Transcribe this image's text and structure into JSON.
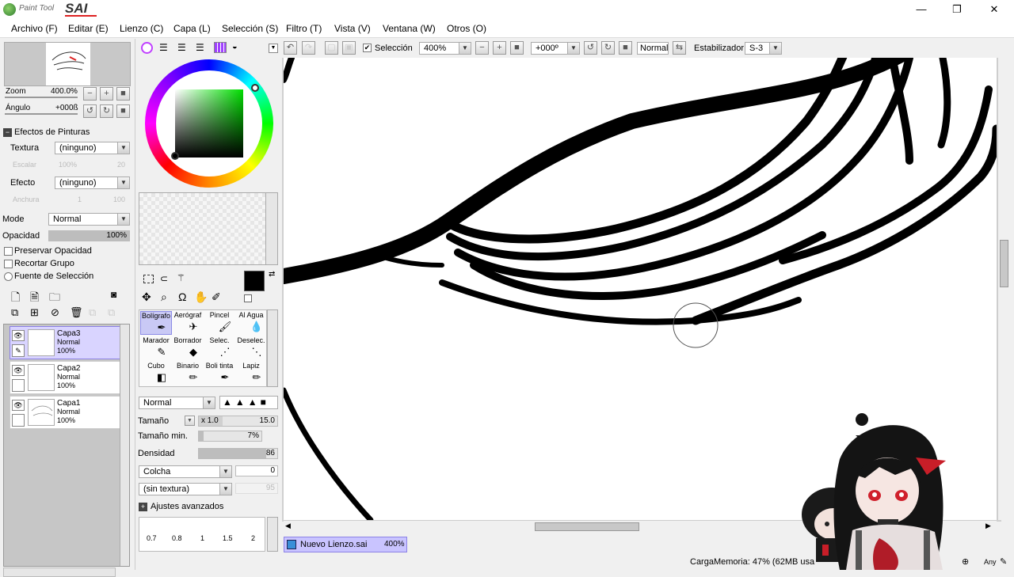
{
  "window": {
    "logo_small": "Paint Tool",
    "logo_big": "SAI",
    "min": "—",
    "max": "❐",
    "close": "✕"
  },
  "menu": [
    "Archivo (F)",
    "Editar (E)",
    "Lienzo (C)",
    "Capa (L)",
    "Selección (S)",
    "Filtro (T)",
    "Vista (V)",
    "Ventana (W)",
    "Otros (O)"
  ],
  "navigator": {
    "zoom_label": "Zoom",
    "zoom_value": "400.0%",
    "angle_label": "Ángulo",
    "angle_value": "+000ß"
  },
  "effects": {
    "title": "Efectos de Pinturas",
    "texture_label": "Textura",
    "texture_value": "(ninguno)",
    "scale_label": "Escalar",
    "scale_value": "100%",
    "scale_num": "20",
    "effect_label": "Efecto",
    "effect_value": "(ninguno)",
    "width_label": "Anchura",
    "width_value": "1",
    "width_num": "100"
  },
  "layer_props": {
    "mode_label": "Mode",
    "mode_value": "Normal",
    "opacity_label": "Opacidad",
    "opacity_value": "100%",
    "preserve": "Preservar Opacidad",
    "clip": "Recortar Grupo",
    "sel_source": "Fuente de Selección"
  },
  "layers": [
    {
      "name": "Capa3",
      "mode": "Normal",
      "opacity": "100%",
      "selected": true
    },
    {
      "name": "Capa2",
      "mode": "Normal",
      "opacity": "100%",
      "selected": false
    },
    {
      "name": "Capa1",
      "mode": "Normal",
      "opacity": "100%",
      "selected": false
    }
  ],
  "tools": [
    {
      "name": "Bolígrafo",
      "icon": "✒"
    },
    {
      "name": "Aerógraf",
      "icon": "✈"
    },
    {
      "name": "Pincel",
      "icon": "🖌"
    },
    {
      "name": "Al Agua",
      "icon": "💧"
    },
    {
      "name": "Marador",
      "icon": "✎"
    },
    {
      "name": "Borrador",
      "icon": "◆"
    },
    {
      "name": "Selec.",
      "icon": "⋰"
    },
    {
      "name": "Deselec.",
      "icon": "⋱"
    },
    {
      "name": "Cubo",
      "icon": "◧"
    },
    {
      "name": "Binario",
      "icon": "✏"
    },
    {
      "name": "Boli tinta",
      "icon": "✒"
    },
    {
      "name": "Lapiz",
      "icon": "✏"
    }
  ],
  "brush": {
    "mode_value": "Normal",
    "size_label": "Tamaño",
    "size_mult": "x 1.0",
    "size_value": "15.0",
    "minsize_label": "Tamaño min.",
    "minsize_value": "7%",
    "minsize_fraction": 0.07,
    "density_label": "Densidad",
    "density_value": "86",
    "density_fraction": 0.86,
    "blend_label": "Colcha",
    "blend_value": "0",
    "texture_value": "(sin textura)",
    "texture_num": "95",
    "advanced_label": "Ajustes avanzados",
    "sizes": [
      "0.7",
      "0.8",
      "1",
      "1.5",
      "2"
    ]
  },
  "toolbar": {
    "selection_label": "Selección",
    "zoom_value": "400%",
    "angle_value": "+000º",
    "mode_value": "Normal",
    "stabilizer_label": "Estabilizador",
    "stabilizer_value": "S-3"
  },
  "tab": {
    "name": "Nuevo Lienzo.sai",
    "zoom": "400%"
  },
  "status": {
    "memory": "CargaMemoria: 47% (62MB usa",
    "any": "Any"
  },
  "colors": {
    "selected_layer": "#d9d4ff",
    "primary_color": "#000000"
  }
}
